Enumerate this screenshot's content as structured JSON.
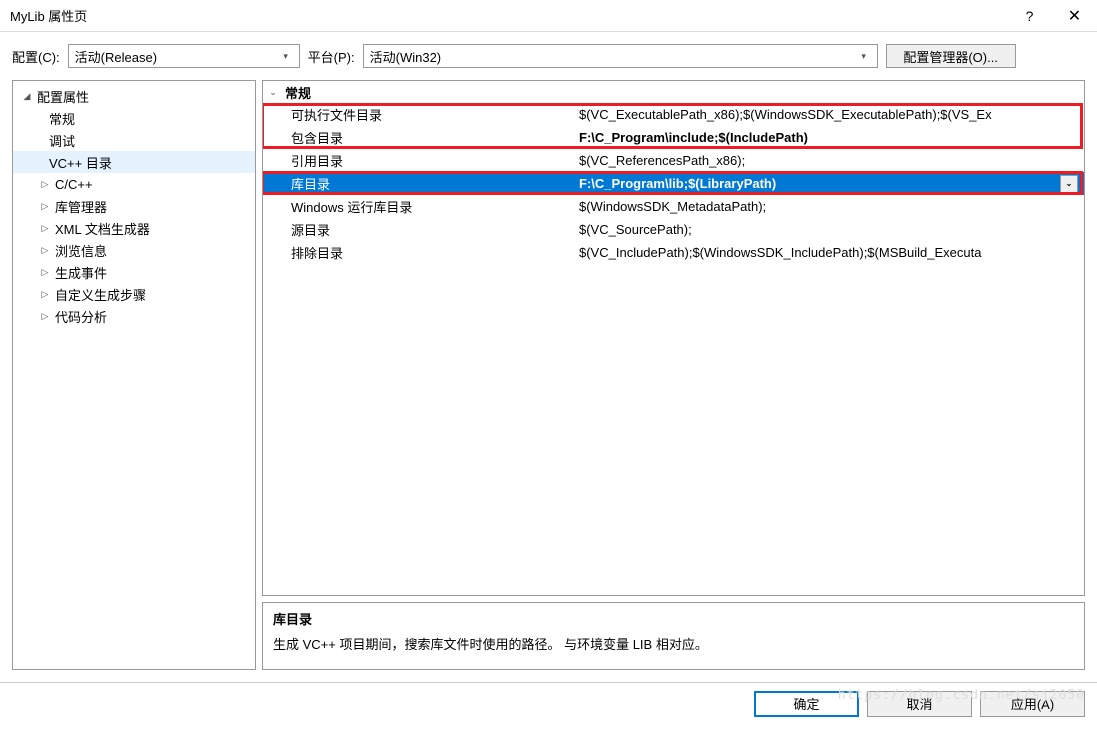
{
  "window": {
    "title": "MyLib 属性页",
    "help": "?",
    "close": "✕"
  },
  "toolbar": {
    "config_label": "配置(C):",
    "config_value": "活动(Release)",
    "platform_label": "平台(P):",
    "platform_value": "活动(Win32)",
    "config_mgr": "配置管理器(O)..."
  },
  "tree": {
    "root": "配置属性",
    "items": [
      "常规",
      "调试",
      "VC++ 目录",
      "C/C++",
      "库管理器",
      "XML 文档生成器",
      "浏览信息",
      "生成事件",
      "自定义生成步骤",
      "代码分析"
    ],
    "selected_index": 2
  },
  "grid": {
    "header": "常规",
    "rows": [
      {
        "label": "可执行文件目录",
        "value": "$(VC_ExecutablePath_x86);$(WindowsSDK_ExecutablePath);$(VS_Ex"
      },
      {
        "label": "包含目录",
        "value": "F:\\C_Program\\include;$(IncludePath)",
        "bold": true
      },
      {
        "label": "引用目录",
        "value": "$(VC_ReferencesPath_x86);"
      },
      {
        "label": "库目录",
        "value": "F:\\C_Program\\lib;$(LibraryPath)",
        "selected": true
      },
      {
        "label": "Windows 运行库目录",
        "value": "$(WindowsSDK_MetadataPath);"
      },
      {
        "label": "源目录",
        "value": "$(VC_SourcePath);"
      },
      {
        "label": "排除目录",
        "value": "$(VC_IncludePath);$(WindowsSDK_IncludePath);$(MSBuild_Executa"
      }
    ]
  },
  "description": {
    "title": "库目录",
    "text": "生成 VC++ 项目期间，搜索库文件时使用的路径。 与环境变量 LIB 相对应。"
  },
  "footer": {
    "ok": "确定",
    "cancel": "取消",
    "apply": "应用(A)"
  },
  "watermark": "https://blog.csdn.net/sj2050"
}
